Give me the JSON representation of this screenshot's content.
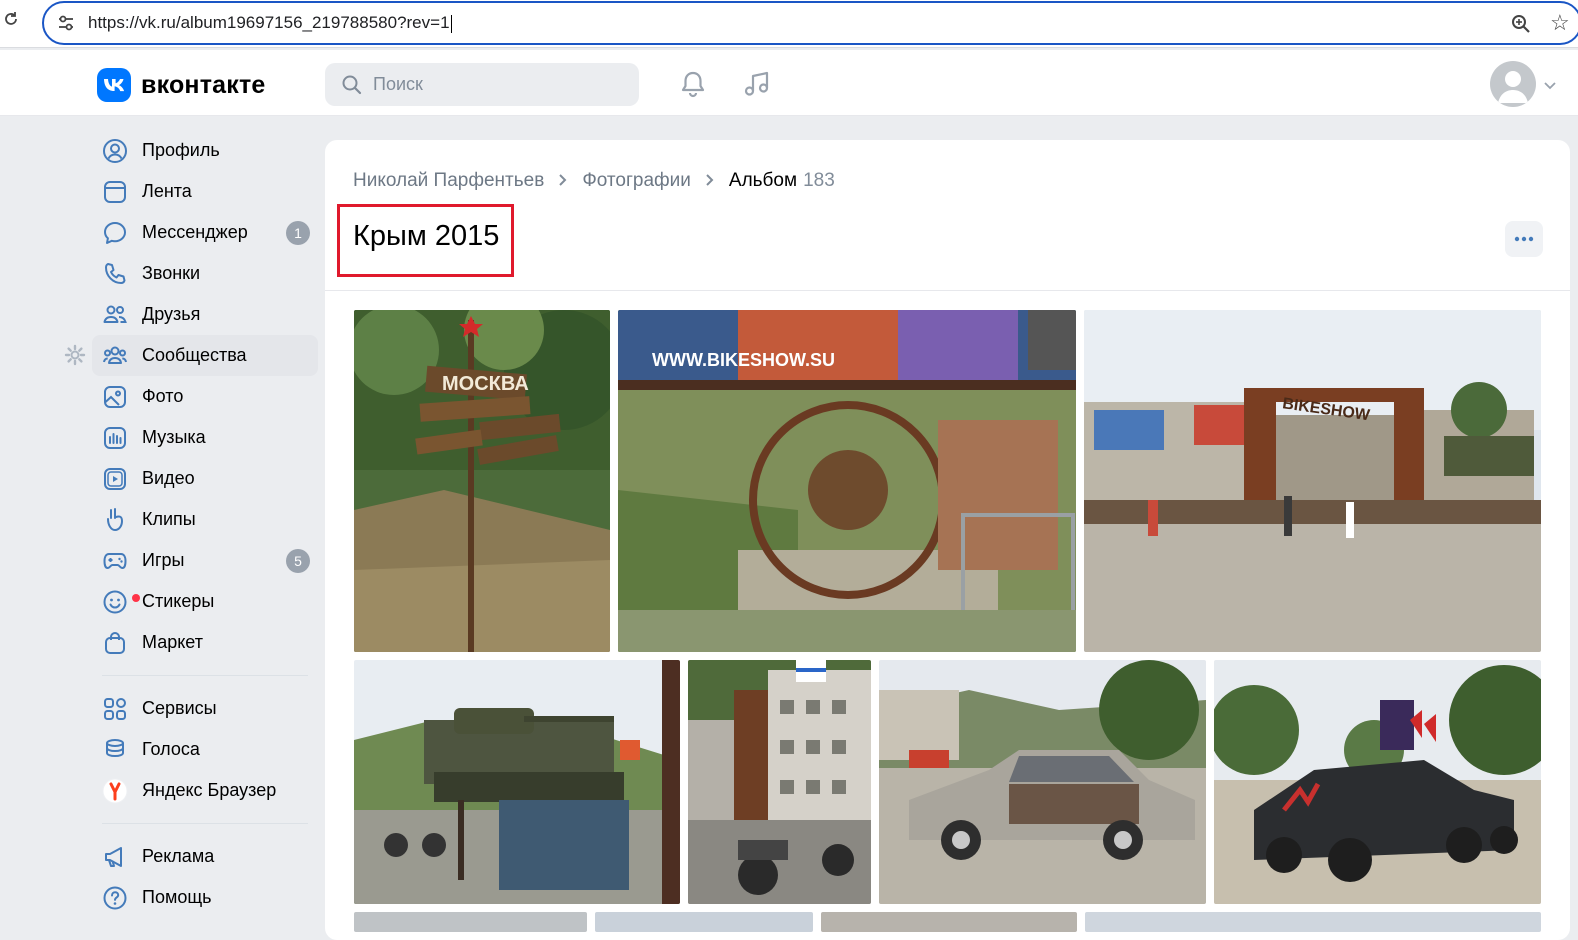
{
  "browser": {
    "url": "https://vk.ru/album19697156_219788580?rev=1"
  },
  "header": {
    "logo_text": "вконтакте",
    "logo_letter": "K",
    "search_placeholder": "Поиск"
  },
  "sidebar": {
    "items": [
      {
        "label": "Профиль",
        "icon": "user-circle-icon"
      },
      {
        "label": "Лента",
        "icon": "feed-icon"
      },
      {
        "label": "Мессенджер",
        "icon": "message-icon",
        "badge": "1"
      },
      {
        "label": "Звонки",
        "icon": "phone-icon"
      },
      {
        "label": "Друзья",
        "icon": "friends-icon"
      },
      {
        "label": "Сообщества",
        "icon": "communities-icon",
        "active": true
      },
      {
        "label": "Фото",
        "icon": "photo-icon"
      },
      {
        "label": "Музыка",
        "icon": "music-icon"
      },
      {
        "label": "Видео",
        "icon": "video-icon"
      },
      {
        "label": "Клипы",
        "icon": "clips-icon"
      },
      {
        "label": "Игры",
        "icon": "gamepad-icon",
        "badge": "5"
      },
      {
        "label": "Стикеры",
        "icon": "sticker-icon"
      },
      {
        "label": "Маркет",
        "icon": "market-icon"
      },
      {
        "label": "Сервисы",
        "icon": "services-icon"
      },
      {
        "label": "Голоса",
        "icon": "coins-icon"
      },
      {
        "label": "Яндекс Браузер",
        "icon": "yandex-icon"
      },
      {
        "label": "Реклама",
        "icon": "megaphone-icon"
      },
      {
        "label": "Помощь",
        "icon": "help-icon"
      }
    ]
  },
  "main": {
    "breadcrumb": {
      "owner": "Николай Парфентьев",
      "section": "Фотографии",
      "current": "Альбом",
      "count": "183"
    },
    "album_title": "Крым 2015",
    "photos": [
      {
        "alt": "Signpost Moscow",
        "sign_text": "МОСКВА"
      },
      {
        "alt": "Bikeshow banner",
        "sign_text": "WWW.BIKESHOW.SU"
      },
      {
        "alt": "Bikeshow gate",
        "sign_text": "BIKESHOW"
      },
      {
        "alt": "Tank on pedestal"
      },
      {
        "alt": "Building with flag"
      },
      {
        "alt": "Vintage car"
      },
      {
        "alt": "Custom vehicle"
      }
    ]
  },
  "colors": {
    "accent": "#0077ff",
    "highlight_frame": "#e0192c",
    "page_bg": "#ebedf0"
  }
}
